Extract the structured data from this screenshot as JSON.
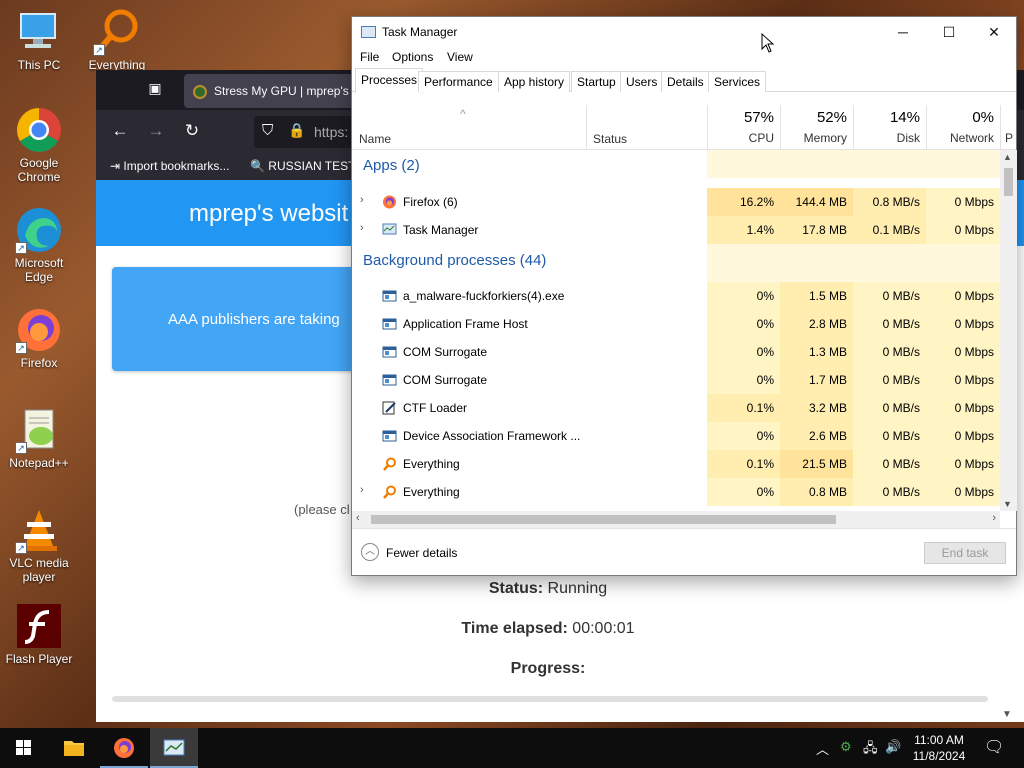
{
  "desktop": {
    "icons": [
      {
        "label": "This PC"
      },
      {
        "label": "Everything"
      },
      {
        "label": "Google Chrome"
      },
      {
        "label": "Microsoft Edge"
      },
      {
        "label": "Firefox"
      },
      {
        "label": "Notepad++"
      },
      {
        "label": "VLC media player"
      },
      {
        "label": "Flash Player"
      }
    ]
  },
  "firefox": {
    "tab_title": "Stress My GPU | mprep's w",
    "url": "https:",
    "bookmarks": [
      "Import bookmarks...",
      "RUSSIAN TEST"
    ],
    "site_header": "mprep's websit",
    "banner_text": "AAA publishers are taking",
    "please_text": "(please cl",
    "status_label": "Status:",
    "status_value": "Running",
    "elapsed_label": "Time elapsed:",
    "elapsed_value": "00:00:01",
    "progress_label": "Progress:"
  },
  "taskmanager": {
    "title": "Task Manager",
    "menu": [
      "File",
      "Options",
      "View"
    ],
    "tabs": [
      "Processes",
      "Performance",
      "App history",
      "Startup",
      "Users",
      "Details",
      "Services"
    ],
    "active_tab": "Processes",
    "columns": {
      "name": "Name",
      "status": "Status",
      "cpu": {
        "pct": "57%",
        "label": "CPU"
      },
      "memory": {
        "pct": "52%",
        "label": "Memory"
      },
      "disk": {
        "pct": "14%",
        "label": "Disk"
      },
      "network": {
        "pct": "0%",
        "label": "Network"
      },
      "power": "P"
    },
    "groups": {
      "apps": "Apps (2)",
      "background": "Background processes (44)"
    },
    "apps": [
      {
        "name": "Firefox (6)",
        "cpu": "16.2%",
        "memory": "144.4 MB",
        "disk": "0.8 MB/s",
        "network": "0 Mbps",
        "icon": "firefox-icon",
        "expandable": true
      },
      {
        "name": "Task Manager",
        "cpu": "1.4%",
        "memory": "17.8 MB",
        "disk": "0.1 MB/s",
        "network": "0 Mbps",
        "icon": "task-manager-icon",
        "expandable": true
      }
    ],
    "background": [
      {
        "name": "a_malware-fuckforkiers(4).exe",
        "cpu": "0%",
        "memory": "1.5 MB",
        "disk": "0 MB/s",
        "network": "0 Mbps",
        "icon": "window-icon"
      },
      {
        "name": "Application Frame Host",
        "cpu": "0%",
        "memory": "2.8 MB",
        "disk": "0 MB/s",
        "network": "0 Mbps",
        "icon": "window-icon"
      },
      {
        "name": "COM Surrogate",
        "cpu": "0%",
        "memory": "1.3 MB",
        "disk": "0 MB/s",
        "network": "0 Mbps",
        "icon": "window-icon"
      },
      {
        "name": "COM Surrogate",
        "cpu": "0%",
        "memory": "1.7 MB",
        "disk": "0 MB/s",
        "network": "0 Mbps",
        "icon": "window-icon"
      },
      {
        "name": "CTF Loader",
        "cpu": "0.1%",
        "memory": "3.2 MB",
        "disk": "0 MB/s",
        "network": "0 Mbps",
        "icon": "pen-icon"
      },
      {
        "name": "Device Association Framework ...",
        "cpu": "0%",
        "memory": "2.6 MB",
        "disk": "0 MB/s",
        "network": "0 Mbps",
        "icon": "window-icon"
      },
      {
        "name": "Everything",
        "cpu": "0.1%",
        "memory": "21.5 MB",
        "disk": "0 MB/s",
        "network": "0 Mbps",
        "icon": "everything-icon"
      },
      {
        "name": "Everything",
        "cpu": "0%",
        "memory": "0.8 MB",
        "disk": "0 MB/s",
        "network": "0 Mbps",
        "icon": "everything-icon",
        "expandable": true
      }
    ],
    "fewer_details": "Fewer details",
    "end_task": "End task"
  },
  "taskbar": {
    "time": "11:00 AM",
    "date": "11/8/2024"
  },
  "colors": {
    "accent": "#2196f3",
    "group_blue": "#1f5aa8"
  }
}
